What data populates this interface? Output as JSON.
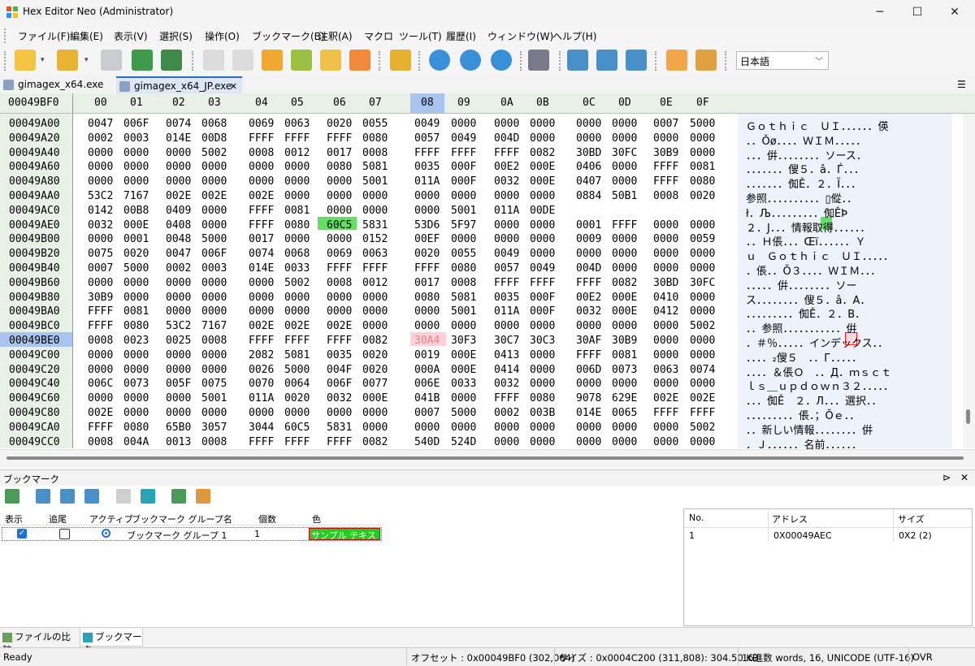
{
  "window": {
    "title": "Hex Editor Neo (Administrator)",
    "minimize": "─",
    "maximize": "☐",
    "close": "✕"
  },
  "menu": [
    "ファイル(F)",
    "編集(E)",
    "表示(V)",
    "選択(S)",
    "操作(O)",
    "ブックマーク(B)",
    "注釈(A)",
    "マクロ",
    "ツール(T)",
    "履歴(I)",
    "ウィンドウ(W)",
    "ヘルプ(H)"
  ],
  "toolbar": {
    "language": "日本語"
  },
  "tabs": [
    {
      "label": "gimagex_x64.exe"
    },
    {
      "label": "gimagex_x64_JP.exe"
    }
  ],
  "tab_close": "✕",
  "hex": {
    "header_address": "00049BF0",
    "columns": [
      "00",
      "01",
      "02",
      "03",
      "04",
      "05",
      "06",
      "07",
      "08",
      "09",
      "0A",
      "0B",
      "0C",
      "0D",
      "0E",
      "0F"
    ],
    "active_column": "08",
    "rows": [
      {
        "addr": "00049A00",
        "words": [
          "0047",
          "006F",
          "0074",
          "0068",
          "0069",
          "0063",
          "0020",
          "0055",
          "0049",
          "0000",
          "0000",
          "0000",
          "0000",
          "0000",
          "0007",
          "5000"
        ],
        "ascii": "Ｇｏｔｈｉｃ　ＵＩ．．．．．．偀"
      },
      {
        "addr": "00049A20",
        "words": [
          "0002",
          "0003",
          "014E",
          "00D8",
          "FFFF",
          "FFFF",
          "FFFF",
          "0080",
          "0057",
          "0049",
          "004D",
          "0000",
          "0000",
          "0000",
          "0000",
          "0000"
        ],
        "ascii": "．．Ŏø．．．．ＷＩＭ．．．．．"
      },
      {
        "addr": "00049A40",
        "words": [
          "0000",
          "0000",
          "0000",
          "5002",
          "0008",
          "0012",
          "0017",
          "0008",
          "FFFF",
          "FFFF",
          "FFFF",
          "0082",
          "30BD",
          "30FC",
          "30B9",
          "0000"
        ],
        "ascii": "．．．倂．．．．．．．．ソース．"
      },
      {
        "addr": "00049A60",
        "words": [
          "0000",
          "0000",
          "0000",
          "0000",
          "0000",
          "0000",
          "0080",
          "5081",
          "0035",
          "000F",
          "00E2",
          "000E",
          "0406",
          "0000",
          "FFFF",
          "0081"
        ],
        "ascii": "．．．．．．．傁５．â．Ѓ．．．"
      },
      {
        "addr": "00049A80",
        "words": [
          "0000",
          "0000",
          "0000",
          "0000",
          "0000",
          "0000",
          "0000",
          "5001",
          "011A",
          "000F",
          "0032",
          "000E",
          "0407",
          "0000",
          "FFFF",
          "0080"
        ],
        "ascii": "．．．．．．．倁Ě．２．Ї．．．"
      },
      {
        "addr": "00049AA0",
        "words": [
          "53C2",
          "7167",
          "002E",
          "002E",
          "002E",
          "0000",
          "0000",
          "0000",
          "0000",
          "0000",
          "0000",
          "0000",
          "0884",
          "50B1",
          "0008",
          "0020"
        ],
        "ascii": "参照．．．．．．．．．．▯傱．．"
      },
      {
        "addr": "00049AC0",
        "words": [
          "0142",
          "00B8",
          "0409",
          "0000",
          "FFFF",
          "0081",
          "0000",
          "0000",
          "0000",
          "5001",
          "011A",
          "00DE",
          "",
          "",
          "",
          ""
        ],
        "ascii": "ł．Љ．．．．．．．．．倁ĚÞ"
      },
      {
        "addr": "00049AE0",
        "words": [
          "0032",
          "000E",
          "0408",
          "0000",
          "FFFF",
          "0080",
          "60C5",
          "5831",
          "53D6",
          "5F97",
          "0000",
          "0000",
          "0001",
          "FFFF",
          "0000",
          "0000"
        ],
        "ascii": "２．Ј．．．情報取得．．．．．．"
      },
      {
        "addr": "00049B00",
        "words": [
          "0000",
          "0001",
          "0048",
          "5000",
          "0017",
          "0000",
          "0000",
          "0152",
          "00EF",
          "0000",
          "0000",
          "0000",
          "0009",
          "0000",
          "0000",
          "0059"
        ],
        "ascii": "．．Ｈ倀．．．Œï．．．．．．Ｙ"
      },
      {
        "addr": "00049B20",
        "words": [
          "0075",
          "0020",
          "0047",
          "006F",
          "0074",
          "0068",
          "0069",
          "0063",
          "0020",
          "0055",
          "0049",
          "0000",
          "0000",
          "0000",
          "0000",
          "0000"
        ],
        "ascii": "ｕ　Ｇｏｔｈｉｃ　ＵＩ．．．．．"
      },
      {
        "addr": "00049B40",
        "words": [
          "0007",
          "5000",
          "0002",
          "0003",
          "014E",
          "0033",
          "FFFF",
          "FFFF",
          "FFFF",
          "0080",
          "0057",
          "0049",
          "004D",
          "0000",
          "0000",
          "0000"
        ],
        "ascii": "．倀．．Ŏ３．．．．ＷＩＭ．．．"
      },
      {
        "addr": "00049B60",
        "words": [
          "0000",
          "0000",
          "0000",
          "0000",
          "0000",
          "5002",
          "0008",
          "0012",
          "0017",
          "0008",
          "FFFF",
          "FFFF",
          "FFFF",
          "0082",
          "30BD",
          "30FC"
        ],
        "ascii": "．．．．．倂．．．．．．．．ソー"
      },
      {
        "addr": "00049B80",
        "words": [
          "30B9",
          "0000",
          "0000",
          "0000",
          "0000",
          "0000",
          "0000",
          "0000",
          "0080",
          "5081",
          "0035",
          "000F",
          "00E2",
          "000E",
          "0410",
          "0000"
        ],
        "ascii": "ス．．．．．．．．傁５．â．А．"
      },
      {
        "addr": "00049BA0",
        "words": [
          "FFFF",
          "0081",
          "0000",
          "0000",
          "0000",
          "0000",
          "0000",
          "0000",
          "0000",
          "5001",
          "011A",
          "000F",
          "0032",
          "000E",
          "0412",
          "0000"
        ],
        "ascii": "．．．．．．．．．倁Ě．２．В．"
      },
      {
        "addr": "00049BC0",
        "words": [
          "FFFF",
          "0080",
          "53C2",
          "7167",
          "002E",
          "002E",
          "002E",
          "0000",
          "0000",
          "0000",
          "0000",
          "0000",
          "0000",
          "0000",
          "0000",
          "5002"
        ],
        "ascii": "．．参照．．．．．．．．．．．倂"
      },
      {
        "addr": "00049BE0",
        "words": [
          "0008",
          "0023",
          "0025",
          "0008",
          "FFFF",
          "FFFF",
          "FFFF",
          "0082",
          "30A4",
          "30F3",
          "30C7",
          "30C3",
          "30AF",
          "30B9",
          "0000",
          "0000"
        ],
        "ascii": "．＃％．．．．．インデックス．．"
      },
      {
        "addr": "00049C00",
        "words": [
          "0000",
          "0000",
          "0000",
          "0000",
          "2082",
          "5081",
          "0035",
          "0020",
          "0019",
          "000E",
          "0413",
          "0000",
          "FFFF",
          "0081",
          "0000",
          "0000"
        ],
        "ascii": "．．．．₂傁５　．．Г．．．．．"
      },
      {
        "addr": "00049C20",
        "words": [
          "0000",
          "0000",
          "0000",
          "0000",
          "0026",
          "5000",
          "004F",
          "0020",
          "000A",
          "000E",
          "0414",
          "0000",
          "006D",
          "0073",
          "0063",
          "0074"
        ],
        "ascii": "．．．．＆倀Ｏ　．．Д．ｍｓｃｔ"
      },
      {
        "addr": "00049C40",
        "words": [
          "006C",
          "0073",
          "005F",
          "0075",
          "0070",
          "0064",
          "006F",
          "0077",
          "006E",
          "0033",
          "0032",
          "0000",
          "0000",
          "0000",
          "0000",
          "0000"
        ],
        "ascii": "ｌｓ＿ｕｐｄｏｗｎ３２．．．．．"
      },
      {
        "addr": "00049C60",
        "words": [
          "0000",
          "0000",
          "0000",
          "5001",
          "011A",
          "0020",
          "0032",
          "000E",
          "041B",
          "0000",
          "FFFF",
          "0080",
          "9078",
          "629E",
          "002E",
          "002E"
        ],
        "ascii": "．．．倁Ě　２．Л．．．選択．．"
      },
      {
        "addr": "00049C80",
        "words": [
          "002E",
          "0000",
          "0000",
          "0000",
          "0000",
          "0000",
          "0000",
          "0000",
          "0007",
          "5000",
          "0002",
          "003B",
          "014E",
          "0065",
          "FFFF",
          "FFFF"
        ],
        "ascii": "．．．．．．．．．倀．；Ŏｅ．．"
      },
      {
        "addr": "00049CA0",
        "words": [
          "FFFF",
          "0080",
          "65B0",
          "3057",
          "3044",
          "60C5",
          "5831",
          "0000",
          "0000",
          "0000",
          "0000",
          "0000",
          "0000",
          "0000",
          "0000",
          "5002"
        ],
        "ascii": "．．新しい情報．．．．．．．．倂"
      },
      {
        "addr": "00049CC0",
        "words": [
          "0008",
          "004A",
          "0013",
          "0008",
          "FFFF",
          "FFFF",
          "FFFF",
          "0082",
          "540D",
          "524D",
          "0000",
          "0000",
          "0000",
          "0000",
          "0000",
          "0000"
        ],
        "ascii": "．Ｊ．．．．．．名前．．．．．．"
      }
    ]
  },
  "bookmarks": {
    "panel_title": "ブックマーク",
    "pin": "⊳",
    "close": "✕",
    "columns": [
      "表示",
      "追尾",
      "アクティブ",
      "ブックマーク グループ名",
      "個数",
      "色"
    ],
    "row": {
      "group": "ブックマーク グループ 1",
      "count": "1",
      "color_label": "サンプル テキスト",
      "color": "#22cc22"
    },
    "detail_columns": [
      "No.",
      "アドレス",
      "サイズ"
    ],
    "detail_row": {
      "no": "1",
      "address": "0X00049AEC",
      "size": "0X2 (2)"
    }
  },
  "bottom_tabs": [
    {
      "label": "ファイルの比較"
    },
    {
      "label": "ブックマーク"
    }
  ],
  "status": {
    "ready": "Ready",
    "offset": "オフセット : 0x00049BF0 (302,064)",
    "size": "サイズ : 0x0004C200 (311,808): 304.50 KB",
    "mode": "16進数 words, 16, UNICODE (UTF-16)",
    "ovr": "OVR"
  },
  "colors": {
    "accent": "#316ac5",
    "bookmark_green": "#66dd66",
    "selection_pink": "#ffd0d8",
    "header_green": "#e9f0e8"
  }
}
